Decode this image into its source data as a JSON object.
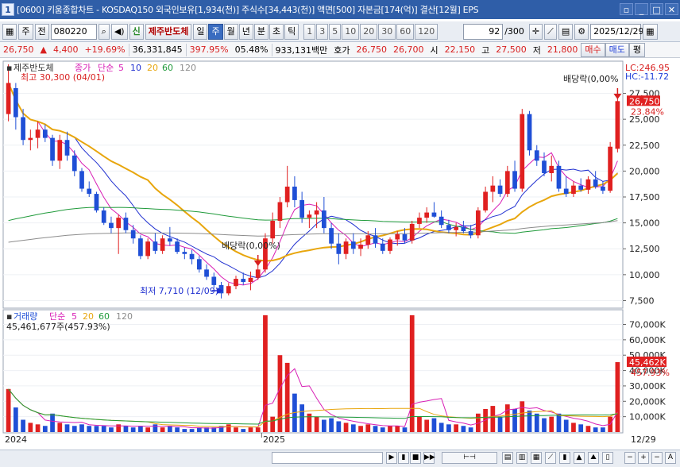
{
  "window": {
    "number": "1",
    "title": "[0600] 키움종합차트 - KOSDAQ150 외국인보유[1,934(천)] 주식수[34,443(천)] 액면[500] 자본금[174(억)] 결산[12월] EPS"
  },
  "toolbar": {
    "period_type": "주",
    "prev_label": "전",
    "code": "080220",
    "new_badge": "신",
    "stock_name": "제주반도체",
    "periods": [
      "일",
      "주",
      "월",
      "년",
      "분",
      "초",
      "틱"
    ],
    "selected_period": "주",
    "intervals": [
      "1",
      "3",
      "5",
      "10",
      "20",
      "30",
      "60",
      "120"
    ],
    "count": "92",
    "count_total": "/300",
    "date": "2025/12/29"
  },
  "quote": {
    "price": "26,750",
    "change": "4,400",
    "change_pct": "+19.69%",
    "volume": "36,331,845",
    "volume_pct": "397.95%",
    "turnover": "05.48%",
    "amount": "933,131백만",
    "bid_label": "호가",
    "ask": "26,750",
    "bid": "26,700",
    "open_label": "시",
    "open": "22,150",
    "high_label": "고",
    "high": "27,500",
    "low_label": "저",
    "low": "21,800",
    "buy_label": "매수",
    "sell_label": "매도",
    "eval_label": "평"
  },
  "price_panel": {
    "stock_name": "제주반도체",
    "legend_prefix": "종가",
    "legend_simple": "단순",
    "ma": [
      "5",
      "10",
      "20",
      "60",
      "120"
    ],
    "ma_colors": [
      "#d81fb5",
      "#1f2fd0",
      "#e8a60d",
      "#1f9a3a",
      "#8c8c8c"
    ],
    "high_note": "최고 30,300 (04/01)",
    "low_note": "최저 7,710 (12/09)",
    "div_note_1": "배당락(0,00%)",
    "div_note_2": "배당락(0,00%",
    "lc": "LC:246.95",
    "hc": "HC:-11.72",
    "last_price": "26,750",
    "last_pct": "23.84%",
    "yticks": [
      "27,500",
      "25,000",
      "22,500",
      "20,000",
      "17,500",
      "15,000",
      "12,500",
      "10,000",
      "7,500"
    ],
    "candle_up_color": "#e02020",
    "candle_down_color": "#1f4fd6"
  },
  "volume_panel": {
    "label": "거래량",
    "legend_simple": "단순",
    "ma": [
      "5",
      "20",
      "60",
      "120"
    ],
    "value_note": "45,461,677주(457.93%)",
    "last_volume": "45,462K",
    "last_pct": "457.93%",
    "yticks": [
      "70,000K",
      "60,000K",
      "50,000K",
      "40,000K",
      "30,000K",
      "20,000K",
      "10,000K"
    ]
  },
  "x_axis": {
    "labels": [
      "2024",
      "2025"
    ],
    "right_label": "12/29"
  },
  "chart_data": {
    "type": "candlestick",
    "period": "weekly",
    "price_ylim": [
      7000,
      30300
    ],
    "volume_ylim": [
      0,
      78000
    ],
    "candles": [
      {
        "o": 25500,
        "h": 30300,
        "l": 24800,
        "c": 28500,
        "v": 28000
      },
      {
        "o": 28000,
        "h": 28500,
        "l": 24000,
        "c": 25200,
        "v": 16000
      },
      {
        "o": 25200,
        "h": 26000,
        "l": 22500,
        "c": 23000,
        "v": 8000
      },
      {
        "o": 23000,
        "h": 24000,
        "l": 22000,
        "c": 23200,
        "v": 6000
      },
      {
        "o": 23200,
        "h": 24800,
        "l": 22200,
        "c": 24000,
        "v": 5000
      },
      {
        "o": 24000,
        "h": 24500,
        "l": 22800,
        "c": 23200,
        "v": 4000
      },
      {
        "o": 23200,
        "h": 23500,
        "l": 20500,
        "c": 21000,
        "v": 12000
      },
      {
        "o": 21000,
        "h": 23500,
        "l": 20200,
        "c": 23000,
        "v": 6000
      },
      {
        "o": 23000,
        "h": 23800,
        "l": 21000,
        "c": 21500,
        "v": 5000
      },
      {
        "o": 21500,
        "h": 22000,
        "l": 19500,
        "c": 20000,
        "v": 4000
      },
      {
        "o": 20000,
        "h": 20300,
        "l": 18000,
        "c": 18300,
        "v": 5000
      },
      {
        "o": 18300,
        "h": 19000,
        "l": 17500,
        "c": 17800,
        "v": 4000
      },
      {
        "o": 17800,
        "h": 18000,
        "l": 16000,
        "c": 16200,
        "v": 4000
      },
      {
        "o": 16200,
        "h": 16500,
        "l": 14800,
        "c": 15000,
        "v": 4000
      },
      {
        "o": 15000,
        "h": 15600,
        "l": 14000,
        "c": 14500,
        "v": 3000
      },
      {
        "o": 14500,
        "h": 15800,
        "l": 12000,
        "c": 15500,
        "v": 5000
      },
      {
        "o": 15500,
        "h": 16000,
        "l": 14000,
        "c": 14300,
        "v": 4000
      },
      {
        "o": 14300,
        "h": 14800,
        "l": 13000,
        "c": 13500,
        "v": 3000
      },
      {
        "o": 13500,
        "h": 13800,
        "l": 11500,
        "c": 11800,
        "v": 4000
      },
      {
        "o": 11800,
        "h": 13500,
        "l": 11500,
        "c": 13200,
        "v": 3000
      },
      {
        "o": 13200,
        "h": 14000,
        "l": 12000,
        "c": 12300,
        "v": 5000
      },
      {
        "o": 12300,
        "h": 13800,
        "l": 12000,
        "c": 13500,
        "v": 3000
      },
      {
        "o": 13500,
        "h": 14600,
        "l": 12800,
        "c": 13200,
        "v": 4000
      },
      {
        "o": 13200,
        "h": 13500,
        "l": 12000,
        "c": 12200,
        "v": 3000
      },
      {
        "o": 12200,
        "h": 12600,
        "l": 11500,
        "c": 12000,
        "v": 2000
      },
      {
        "o": 12000,
        "h": 12400,
        "l": 11000,
        "c": 11500,
        "v": 2000
      },
      {
        "o": 11500,
        "h": 11800,
        "l": 10200,
        "c": 10500,
        "v": 3000
      },
      {
        "o": 10500,
        "h": 11000,
        "l": 9500,
        "c": 9800,
        "v": 3000
      },
      {
        "o": 9800,
        "h": 10200,
        "l": 8700,
        "c": 9000,
        "v": 3000
      },
      {
        "o": 9000,
        "h": 9300,
        "l": 7710,
        "c": 8200,
        "v": 4000
      },
      {
        "o": 8200,
        "h": 9200,
        "l": 8000,
        "c": 8900,
        "v": 5000
      },
      {
        "o": 8900,
        "h": 9900,
        "l": 8600,
        "c": 9600,
        "v": 3000
      },
      {
        "o": 9600,
        "h": 10200,
        "l": 9000,
        "c": 9300,
        "v": 2000
      },
      {
        "o": 9300,
        "h": 10300,
        "l": 8500,
        "c": 9700,
        "v": 3000
      },
      {
        "o": 9700,
        "h": 11000,
        "l": 9500,
        "c": 10500,
        "v": 3000
      },
      {
        "o": 10500,
        "h": 14000,
        "l": 10200,
        "c": 13500,
        "v": 76000
      },
      {
        "o": 13500,
        "h": 16000,
        "l": 13000,
        "c": 15200,
        "v": 10000
      },
      {
        "o": 15200,
        "h": 17500,
        "l": 14500,
        "c": 17000,
        "v": 50000
      },
      {
        "o": 17000,
        "h": 20500,
        "l": 16500,
        "c": 18500,
        "v": 45000
      },
      {
        "o": 18500,
        "h": 19500,
        "l": 16500,
        "c": 17200,
        "v": 25000
      },
      {
        "o": 17200,
        "h": 18000,
        "l": 15000,
        "c": 15500,
        "v": 18000
      },
      {
        "o": 15500,
        "h": 16200,
        "l": 14500,
        "c": 15800,
        "v": 12000
      },
      {
        "o": 15800,
        "h": 17000,
        "l": 14500,
        "c": 16200,
        "v": 10000
      },
      {
        "o": 16200,
        "h": 17500,
        "l": 14000,
        "c": 14500,
        "v": 8000
      },
      {
        "o": 14500,
        "h": 15000,
        "l": 12500,
        "c": 13000,
        "v": 9000
      },
      {
        "o": 13000,
        "h": 14000,
        "l": 11000,
        "c": 12000,
        "v": 7000
      },
      {
        "o": 12000,
        "h": 13500,
        "l": 11500,
        "c": 13200,
        "v": 6000
      },
      {
        "o": 13200,
        "h": 14000,
        "l": 12000,
        "c": 12500,
        "v": 5000
      },
      {
        "o": 12500,
        "h": 13500,
        "l": 11800,
        "c": 12900,
        "v": 4000
      },
      {
        "o": 12900,
        "h": 14200,
        "l": 12500,
        "c": 13800,
        "v": 5000
      },
      {
        "o": 13800,
        "h": 14500,
        "l": 12600,
        "c": 13000,
        "v": 4000
      },
      {
        "o": 13000,
        "h": 13500,
        "l": 12000,
        "c": 12300,
        "v": 3000
      },
      {
        "o": 12300,
        "h": 13600,
        "l": 12000,
        "c": 13400,
        "v": 4000
      },
      {
        "o": 13400,
        "h": 14200,
        "l": 12800,
        "c": 13900,
        "v": 4000
      },
      {
        "o": 13900,
        "h": 14500,
        "l": 13000,
        "c": 13300,
        "v": 3000
      },
      {
        "o": 13300,
        "h": 15200,
        "l": 13000,
        "c": 14900,
        "v": 76000
      },
      {
        "o": 14900,
        "h": 16000,
        "l": 14500,
        "c": 15500,
        "v": 10000
      },
      {
        "o": 15500,
        "h": 16500,
        "l": 15000,
        "c": 16000,
        "v": 8000
      },
      {
        "o": 16000,
        "h": 17000,
        "l": 15500,
        "c": 15600,
        "v": 9000
      },
      {
        "o": 15600,
        "h": 16200,
        "l": 14500,
        "c": 14800,
        "v": 6000
      },
      {
        "o": 14800,
        "h": 15300,
        "l": 14000,
        "c": 14300,
        "v": 5000
      },
      {
        "o": 14300,
        "h": 15000,
        "l": 13700,
        "c": 14600,
        "v": 5000
      },
      {
        "o": 14600,
        "h": 15200,
        "l": 14000,
        "c": 14200,
        "v": 4000
      },
      {
        "o": 14200,
        "h": 14800,
        "l": 13500,
        "c": 13800,
        "v": 3000
      },
      {
        "o": 13800,
        "h": 16500,
        "l": 13500,
        "c": 16200,
        "v": 12000
      },
      {
        "o": 16200,
        "h": 18500,
        "l": 16000,
        "c": 18000,
        "v": 15000
      },
      {
        "o": 18000,
        "h": 19500,
        "l": 17000,
        "c": 18600,
        "v": 17000
      },
      {
        "o": 18600,
        "h": 19200,
        "l": 17500,
        "c": 17800,
        "v": 10000
      },
      {
        "o": 17800,
        "h": 20500,
        "l": 17500,
        "c": 20000,
        "v": 18000
      },
      {
        "o": 20000,
        "h": 21000,
        "l": 18000,
        "c": 18300,
        "v": 15000
      },
      {
        "o": 18300,
        "h": 26000,
        "l": 18000,
        "c": 25500,
        "v": 20000
      },
      {
        "o": 25500,
        "h": 25800,
        "l": 21500,
        "c": 22000,
        "v": 14000
      },
      {
        "o": 22000,
        "h": 22500,
        "l": 20500,
        "c": 21000,
        "v": 12000
      },
      {
        "o": 21000,
        "h": 21800,
        "l": 19500,
        "c": 19800,
        "v": 9000
      },
      {
        "o": 19800,
        "h": 21500,
        "l": 19000,
        "c": 20500,
        "v": 10000
      },
      {
        "o": 20500,
        "h": 21000,
        "l": 18000,
        "c": 18300,
        "v": 12000
      },
      {
        "o": 18300,
        "h": 19500,
        "l": 17500,
        "c": 17800,
        "v": 8000
      },
      {
        "o": 17800,
        "h": 19000,
        "l": 17500,
        "c": 18600,
        "v": 6000
      },
      {
        "o": 18600,
        "h": 19300,
        "l": 18000,
        "c": 18200,
        "v": 5000
      },
      {
        "o": 18200,
        "h": 19500,
        "l": 17800,
        "c": 19200,
        "v": 4000
      },
      {
        "o": 19200,
        "h": 20000,
        "l": 18300,
        "c": 18500,
        "v": 3000
      },
      {
        "o": 18500,
        "h": 19000,
        "l": 17800,
        "c": 18100,
        "v": 3000
      },
      {
        "o": 18100,
        "h": 22800,
        "l": 17900,
        "c": 22350,
        "v": 10000
      },
      {
        "o": 22150,
        "h": 27500,
        "l": 21800,
        "c": 26750,
        "v": 45462
      }
    ]
  }
}
